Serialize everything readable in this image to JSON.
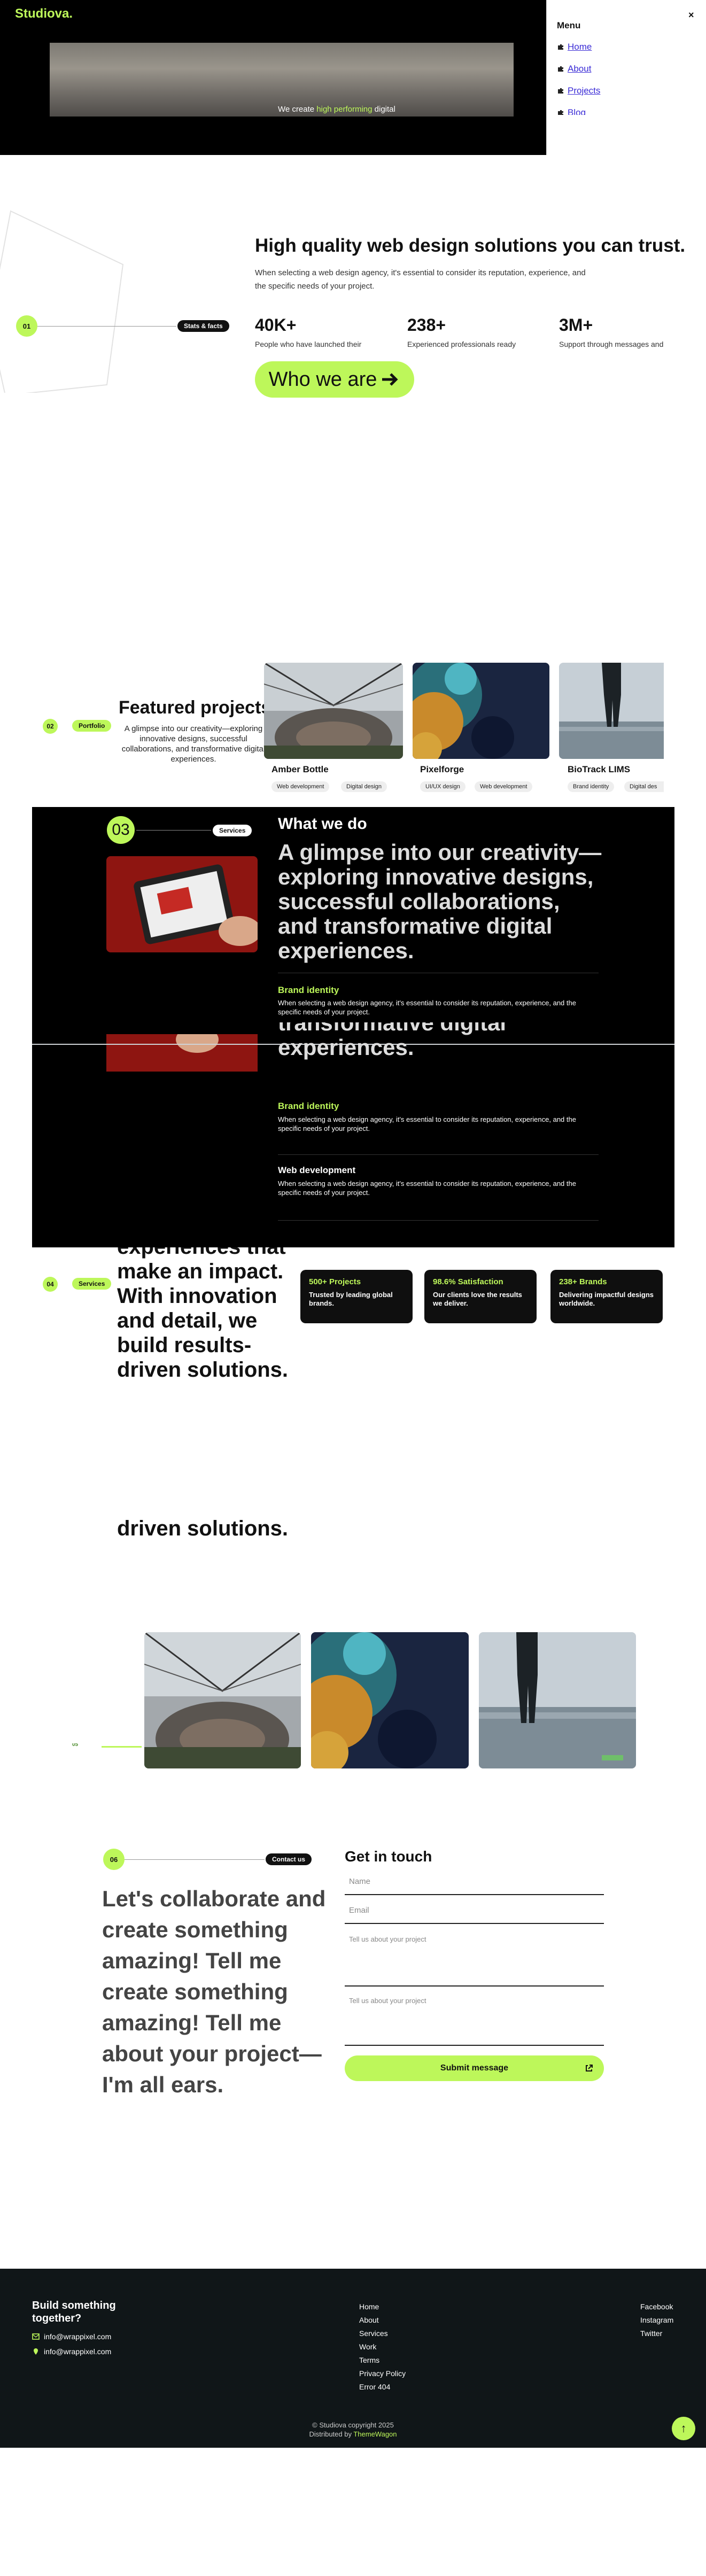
{
  "brand": {
    "logo": "Studiova.",
    "accent": "#bdf75a"
  },
  "hero": {
    "caption_pre": "We create ",
    "caption_hl": "high performing",
    "caption_post": " digital"
  },
  "menu": {
    "title": "Menu",
    "close": "×",
    "items": [
      {
        "label": "Home"
      },
      {
        "label": "About"
      },
      {
        "label": "Projects"
      },
      {
        "label": "Blog"
      }
    ]
  },
  "stats_section": {
    "number": "01",
    "tag": "Stats & facts",
    "title": "High quality web design solutions you can trust.",
    "description": "When selecting a web design agency, it's essential to consider its reputation, experience, and the specific needs of your project.",
    "stats": [
      {
        "value": "40K+",
        "label": "People who have launched their"
      },
      {
        "value": "238+",
        "label": "Experienced professionals ready"
      },
      {
        "value": "3M+",
        "label": "Support through messages and"
      }
    ],
    "cta": "Who we are",
    "cta_icon": "arrow-right-icon"
  },
  "portfolio": {
    "number": "02",
    "tag": "Portfolio",
    "title": "Featured projects",
    "description": "A glimpse into our creativity—exploring innovative designs, successful collaborations, and transformative digital experiences.",
    "projects": [
      {
        "title": "Amber Bottle",
        "tags": [
          "Web development",
          "Digital design"
        ]
      },
      {
        "title": "Pixelforge",
        "tags": [
          "UI/UX design",
          "Web development"
        ]
      },
      {
        "title": "BioTrack LIMS",
        "tags": [
          "Brand identity",
          "Digital des"
        ]
      }
    ]
  },
  "services": {
    "number": "03",
    "tag": "Services",
    "heading": "What we do",
    "big_text": "A glimpse into our creativity—exploring innovative designs, successful collaborations, and transformative digital experiences.",
    "big_text_tail_1": "transformative digital",
    "big_text_tail_2": "experiences.",
    "items": [
      {
        "title": "Brand identity",
        "description": "When selecting a web design agency, it's essential to consider its reputation, experience, and the specific needs of your project."
      },
      {
        "title": "Brand identity",
        "description": "When selecting a web design agency, it's essential to consider its reputation, experience, and the specific needs of your project."
      },
      {
        "title": "Web development",
        "description": "When selecting a web design agency, it's essential to consider its reputation, experience, and the specific needs of your project."
      }
    ]
  },
  "why_us": {
    "number": "04",
    "tag": "Services",
    "big_text": "experiences that make an impact. With innovation and detail, we build results-driven solutions.",
    "repeat_text": "driven solutions.",
    "cards": [
      {
        "title": "500+ Projects",
        "description": "Trusted by leading global brands."
      },
      {
        "title": "98.6% Satisfaction",
        "description": "Our clients love the results we deliver."
      },
      {
        "title": "238+ Brands",
        "description": "Delivering impactful designs worldwide."
      }
    ]
  },
  "gallery": {
    "number": "05"
  },
  "contact": {
    "number": "06",
    "tag": "Contact us",
    "big_text": "Let's collaborate and create something amazing! Tell me create something amazing! Tell me about your project—I'm all ears.",
    "heading": "Get in touch",
    "name_placeholder": "Name",
    "email_placeholder": "Email",
    "message_placeholder": "Tell us about your project",
    "message2_placeholder": "Tell us about your project",
    "submit": "Submit message"
  },
  "footer": {
    "heading": "Build something together?",
    "emails": [
      "info@wrappixel.com",
      "info@wrappixel.com"
    ],
    "links": [
      "Home",
      "About",
      "Services",
      "Work",
      "Terms",
      "Privacy Policy",
      "Error 404"
    ],
    "social": [
      "Facebook",
      "Instagram",
      "Twitter"
    ],
    "copyright": "© Studiova copyright 2025",
    "distributed_pre": "Distributed by ",
    "distributed_by": "ThemeWagon",
    "back_to_top": "↑"
  }
}
